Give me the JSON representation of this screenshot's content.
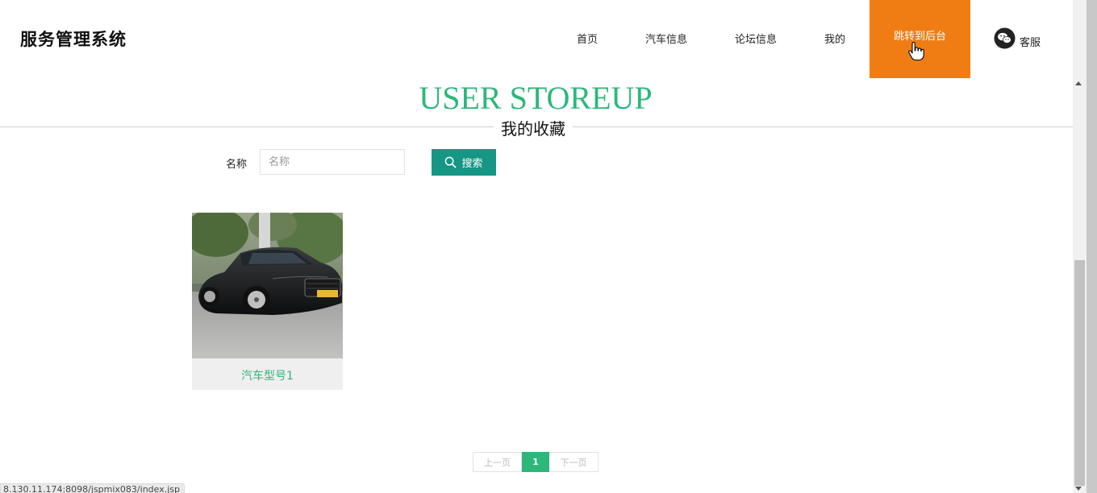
{
  "header": {
    "site_title": "服务管理系统",
    "nav": [
      {
        "label": "首页"
      },
      {
        "label": "汽车信息"
      },
      {
        "label": "论坛信息"
      },
      {
        "label": "我的"
      },
      {
        "label": "跳转到后台"
      }
    ],
    "service_label": "客服",
    "colors": {
      "admin_bg": "#ef7d14"
    }
  },
  "section": {
    "title_en": "USER STOREUP",
    "title_cn": "我的收藏",
    "accent_color": "#2cb77b"
  },
  "search": {
    "label": "名称",
    "placeholder": "名称",
    "value": "",
    "button_label": "搜索",
    "button_icon": "search-icon",
    "button_color": "#169684"
  },
  "items": [
    {
      "title": "汽车型号1",
      "image": "black-sedan-photo"
    }
  ],
  "pagination": {
    "prev_label": "上一页",
    "current": "1",
    "next_label": "下一页"
  },
  "status_bar": {
    "url": "8.130.11.174:8098/jspmix083/index.jsp"
  }
}
